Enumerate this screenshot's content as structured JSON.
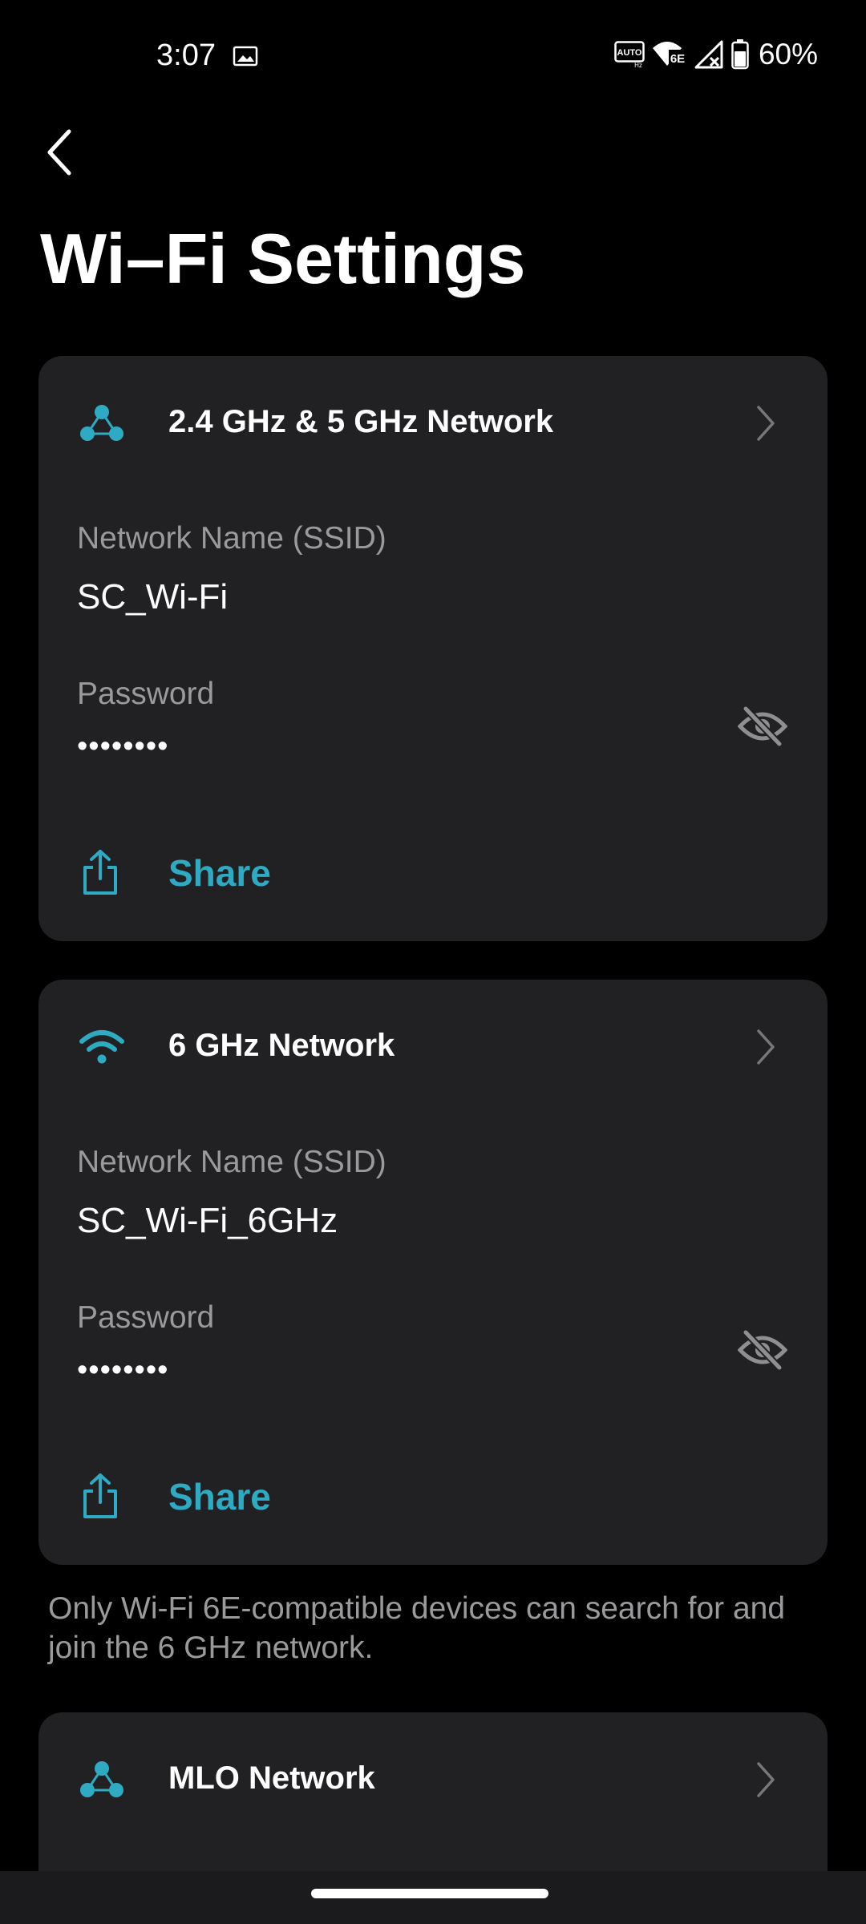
{
  "status_bar": {
    "time": "3:07",
    "battery_percent": "60%",
    "icons": [
      "gallery-icon",
      "auto-hz-icon",
      "wifi-6e-icon",
      "signal-no-service-icon",
      "battery-icon"
    ],
    "auto_hz_label": "AUTO",
    "wifi_badge": "6E"
  },
  "header": {
    "back_icon": "back-arrow-icon",
    "title": "Wi–Fi Settings"
  },
  "networks": [
    {
      "icon": "mesh-network-icon",
      "title": "2.4 GHz & 5 GHz Network",
      "ssid_label": "Network Name (SSID)",
      "ssid": "SC_Wi-Fi",
      "password_label": "Password",
      "password_masked": "••••••••",
      "share_label": "Share"
    },
    {
      "icon": "wifi-icon",
      "title": "6 GHz Network",
      "ssid_label": "Network Name (SSID)",
      "ssid": "SC_Wi-Fi_6GHz",
      "password_label": "Password",
      "password_masked": "••••••••",
      "share_label": "Share"
    },
    {
      "icon": "mesh-network-icon",
      "title": "MLO Network"
    }
  ],
  "note": "Only Wi-Fi 6E-compatible devices can search for and join the 6 GHz network.",
  "colors": {
    "background": "#000000",
    "card": "#212123",
    "accent": "#2eaac2",
    "secondary_text": "#9a9a9c"
  }
}
